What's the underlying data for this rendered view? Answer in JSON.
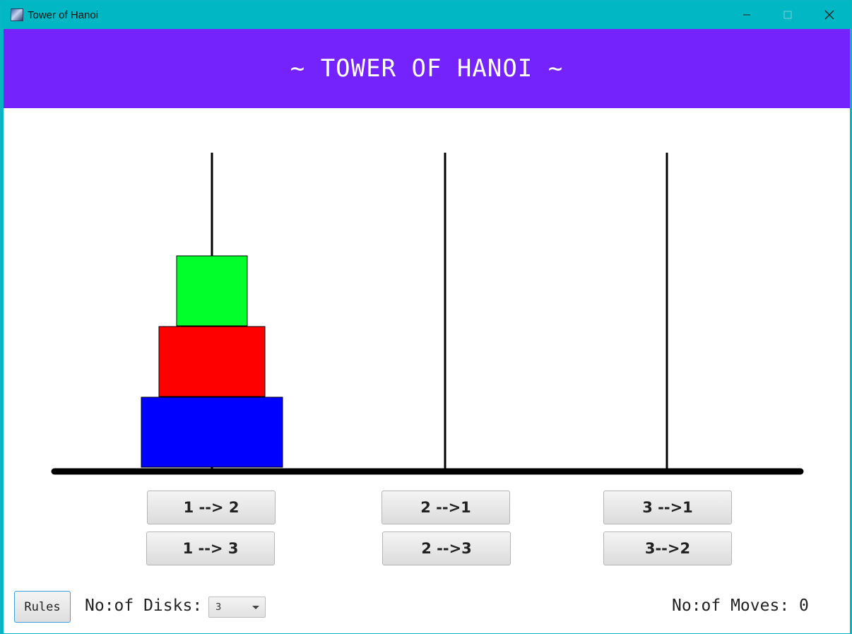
{
  "window": {
    "title": "Tower of Hanoi",
    "icon": "app-icon",
    "controls": [
      "minimize-icon",
      "maximize-icon",
      "close-icon"
    ]
  },
  "header": {
    "title": "~ TOWER OF HANOI ~",
    "background": "#7523fd"
  },
  "game": {
    "pegs": 3,
    "disks": [
      {
        "size": 3,
        "peg": 1,
        "color": "#0000ff"
      },
      {
        "size": 2,
        "peg": 1,
        "color": "#ff0000"
      },
      {
        "size": 1,
        "peg": 1,
        "color": "#00ff2b"
      }
    ]
  },
  "moves": {
    "m12": "1 --> 2",
    "m13": "1 --> 3",
    "m21": "2 -->1",
    "m23": "2 -->3",
    "m31": "3 -->1",
    "m32": "3-->2"
  },
  "footer": {
    "rules_label": "Rules",
    "disks_label": "No:of Disks:",
    "disks_value": "3",
    "moves_label": "No:of Moves:",
    "moves_value": "0"
  }
}
